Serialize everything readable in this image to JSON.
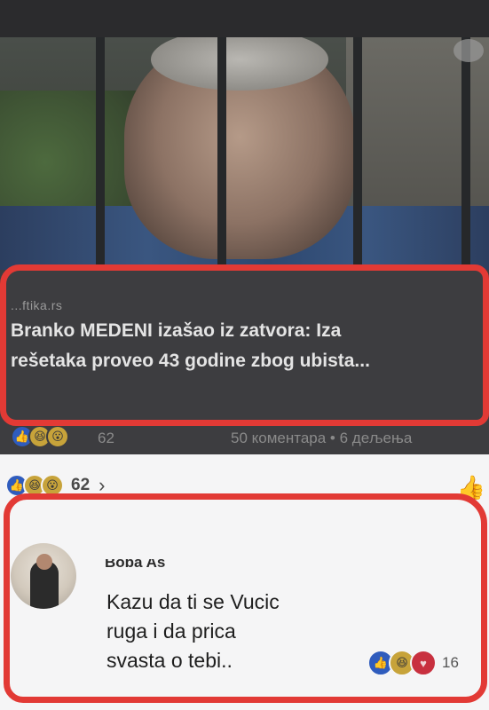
{
  "post": {
    "link": {
      "source": "...ftika.rs",
      "headline_line1": "Branko MEDENI izašao iz zatvora: Iza",
      "headline_line2": "rešetaka proveo 43 godine zbog ubista..."
    },
    "stats": {
      "reaction_icons": [
        "like-icon",
        "haha-icon",
        "wow-icon"
      ],
      "reaction_count": "62",
      "comments_and_shares": "50 коментара • 6 дељења"
    }
  },
  "comments_section": {
    "reply_reaction_icons": [
      "like-icon",
      "haha-icon",
      "wow-icon"
    ],
    "reply_count": "62",
    "comment": {
      "author": "Boba As",
      "text_lines": [
        "Kazu da ti se Vucic",
        "ruga i da prica",
        "svasta o tebi.."
      ],
      "reaction_icons": [
        "like-icon",
        "haha-icon",
        "love-icon"
      ],
      "reaction_count": "16"
    }
  },
  "colors": {
    "highlight": "#e23a35",
    "like": "#2f5cbd",
    "haha": "#c7a33a",
    "love": "#c8303f"
  }
}
